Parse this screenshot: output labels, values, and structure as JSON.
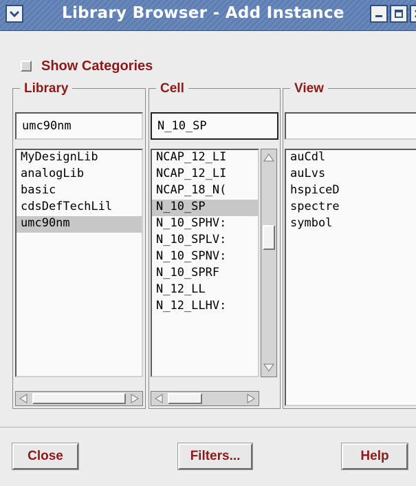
{
  "window": {
    "title": "Library Browser - Add Instance",
    "icons": [
      "chevron-down-icon",
      "minimize-icon",
      "maximize-icon",
      "close-icon"
    ]
  },
  "show_categories": {
    "label": "Show Categories",
    "checked": false
  },
  "library": {
    "legend": "Library",
    "entry_value": "umc90nm",
    "items": [
      "MyDesignLib",
      "analogLib",
      "basic",
      "cdsDefTechLil",
      "umc90nm"
    ],
    "selected": "umc90nm"
  },
  "cell": {
    "legend": "Cell",
    "entry_value": "N_10_SP",
    "items": [
      "NCAP_12_LI",
      "NCAP_12_LI",
      "NCAP_18_N(",
      "N_10_SP",
      "N_10_SPHV:",
      "N_10_SPLV:",
      "N_10_SPNV:",
      "N_10_SPRF",
      "N_12_LL",
      "N_12_LLHV:"
    ],
    "selected": "N_10_SP"
  },
  "view": {
    "legend": "View",
    "entry_value": "",
    "items": [
      "auCdl",
      "auLvs",
      "hspiceD",
      "spectre",
      "symbol"
    ]
  },
  "buttons": {
    "close": "Close",
    "filters": "Filters...",
    "help": "Help"
  },
  "colors": {
    "accent_label": "#8b1a1a",
    "titlebar": "#5d7fb3",
    "selection": "#c7c7c7"
  }
}
